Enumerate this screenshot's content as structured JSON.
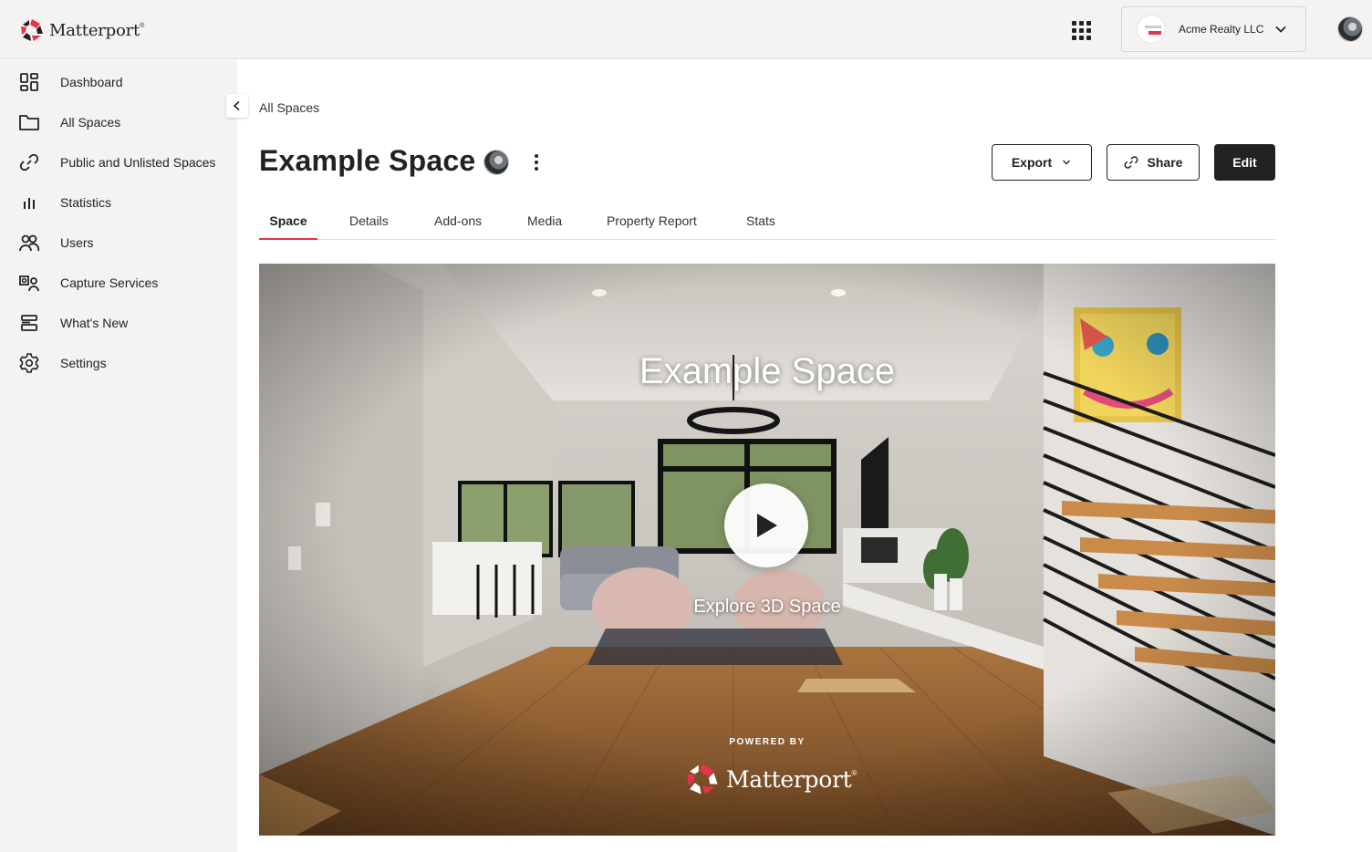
{
  "app": {
    "brand": "Matterport",
    "accent_color": "#e8334a"
  },
  "header": {
    "org_name": "Acme Realty LLC"
  },
  "sidebar": {
    "items": [
      {
        "label": "Dashboard",
        "icon": "dashboard-icon"
      },
      {
        "label": "All Spaces",
        "icon": "folder-icon"
      },
      {
        "label": "Public and Unlisted Spaces",
        "icon": "link-icon"
      },
      {
        "label": "Statistics",
        "icon": "bar-chart-icon"
      },
      {
        "label": "Users",
        "icon": "users-icon"
      },
      {
        "label": "Capture Services",
        "icon": "capture-services-icon"
      },
      {
        "label": "What's New",
        "icon": "whats-new-icon"
      },
      {
        "label": "Settings",
        "icon": "gear-icon"
      }
    ]
  },
  "main": {
    "breadcrumb": "All Spaces",
    "title": "Example Space",
    "actions": {
      "export": "Export",
      "share": "Share",
      "edit": "Edit"
    },
    "tabs": [
      {
        "label": "Space",
        "active": true
      },
      {
        "label": "Details",
        "active": false
      },
      {
        "label": "Add-ons",
        "active": false
      },
      {
        "label": "Media",
        "active": false
      },
      {
        "label": "Property Report",
        "active": false
      },
      {
        "label": "Stats",
        "active": false
      }
    ],
    "hero": {
      "title": "Example Space",
      "cta": "Explore 3D Space",
      "powered_by": "POWERED BY",
      "powered_brand": "Matterport"
    }
  }
}
